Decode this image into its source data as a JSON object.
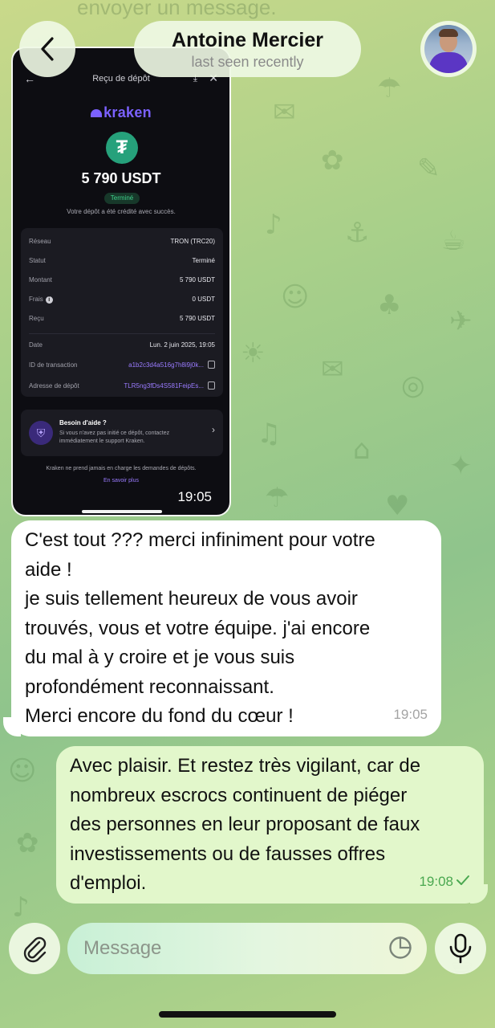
{
  "header": {
    "background_text": "envoyer un message.",
    "contact_name": "Antoine Mercier",
    "status": "last seen recently"
  },
  "screenshot": {
    "header_title": "Reçu de dépôt",
    "brand": "kraken",
    "amount": "5 790 USDT",
    "status_badge": "Terminé",
    "credited_text": "Votre dépôt a été crédité avec succès.",
    "details": [
      {
        "label": "Réseau",
        "value": "TRON (TRC20)"
      },
      {
        "label": "Statut",
        "value": "Terminé"
      },
      {
        "label": "Montant",
        "value": "5 790 USDT"
      },
      {
        "label": "Frais",
        "value": "0 USDT"
      },
      {
        "label": "Reçu",
        "value": "5 790 USDT"
      },
      {
        "label": "Date",
        "value": "Lun. 2 juin 2025, 19:05"
      },
      {
        "label": "ID de transaction",
        "value": "a1b2c3d4a516g7h8i9j0k..."
      },
      {
        "label": "Adresse de dépôt",
        "value": "TLR5ng3fDs4S581FeipEs..."
      }
    ],
    "help_title": "Besoin d'aide ?",
    "help_body": "Si vous n'avez pas initié ce dépôt, contactez immédiatement le support Kraken.",
    "footer_note": "Kraken ne prend jamais en charge les demandes de dépôts.",
    "footer_link": "En savoir plus",
    "time": "19:05"
  },
  "messages": [
    {
      "direction": "incoming",
      "lines": [
        "C'est tout ??? merci infiniment pour votre",
        "aide !",
        "je suis tellement heureux de vous avoir",
        "trouvés, vous et votre équipe. j'ai encore",
        "du mal à y croire et je vous suis",
        "profondément reconnaissant.",
        "Merci encore du fond du cœur !"
      ],
      "time": "19:05"
    },
    {
      "direction": "outgoing",
      "lines": [
        "Avec plaisir. Et restez très vigilant, car de",
        "nombreux escrocs continuent de piéger",
        "des personnes en leur proposant de faux",
        "investissements ou de fausses offres",
        "d'emploi."
      ],
      "time": "19:08",
      "read": true
    }
  ],
  "composer": {
    "placeholder": "Message"
  },
  "icons": [
    "back-icon",
    "attach-icon",
    "sticker-icon",
    "mic-icon",
    "check-icon",
    "tether-icon",
    "shield-icon"
  ],
  "colors": {
    "outgoing_bubble": "#e2f7cb",
    "incoming_bubble": "#ffffff",
    "accent_green": "#4aa850",
    "kraken_purple": "#7b61ff",
    "tether_green": "#26a17b"
  }
}
